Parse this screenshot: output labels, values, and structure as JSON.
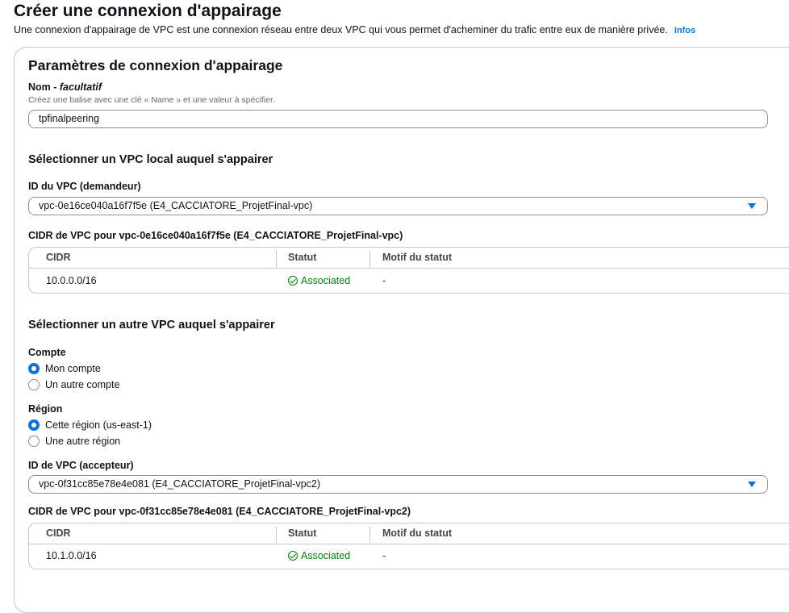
{
  "header": {
    "title": "Créer une connexion d'appairage",
    "description": "Une connexion d'appairage de VPC est une connexion réseau entre deux VPC qui vous permet d'acheminer du trafic entre eux de manière privée.",
    "info_link": "Infos"
  },
  "settings": {
    "title": "Paramètres de connexion d'appairage",
    "name_label": "Nom - ",
    "name_optional": "facultatif",
    "name_desc": "Créez une balise avec une clé « Name » et une valeur à spécifier.",
    "name_value": "tpfinalpeering"
  },
  "local_vpc": {
    "title": "Sélectionner un VPC local auquel s'appairer",
    "vpc_id_label": "ID du VPC (demandeur)",
    "vpc_id_value": "vpc-0e16ce040a16f7f5e (E4_CACCIATORE_ProjetFinal-vpc)",
    "cidr_title": "CIDR de VPC pour vpc-0e16ce040a16f7f5e (E4_CACCIATORE_ProjetFinal-vpc)",
    "table": {
      "columns": [
        "CIDR",
        "Statut",
        "Motif du statut"
      ],
      "rows": [
        {
          "cidr": "10.0.0.0/16",
          "status": "Associated",
          "reason": "-"
        }
      ]
    }
  },
  "peer_vpc": {
    "title": "Sélectionner un autre VPC auquel s'appairer",
    "account_label": "Compte",
    "account_options": [
      "Mon compte",
      "Un autre compte"
    ],
    "account_selected": "Mon compte",
    "region_label": "Région",
    "region_options": [
      "Cette région (us-east-1)",
      "Une autre région"
    ],
    "region_selected": "Cette région (us-east-1)",
    "vpc_id_label": "ID de VPC (accepteur)",
    "vpc_id_value": "vpc-0f31cc85e78e4e081 (E4_CACCIATORE_ProjetFinal-vpc2)",
    "cidr_title": "CIDR de VPC pour vpc-0f31cc85e78e4e081 (E4_CACCIATORE_ProjetFinal-vpc2)",
    "table": {
      "columns": [
        "CIDR",
        "Statut",
        "Motif du statut"
      ],
      "rows": [
        {
          "cidr": "10.1.0.0/16",
          "status": "Associated",
          "reason": "-"
        }
      ]
    }
  },
  "colors": {
    "link": "#0972d3",
    "success": "#037f0c",
    "border": "#c6c6cd",
    "text": "#0f141a"
  },
  "icons": [
    "caret-down-icon",
    "check-circle-icon",
    "radio-icon"
  ]
}
